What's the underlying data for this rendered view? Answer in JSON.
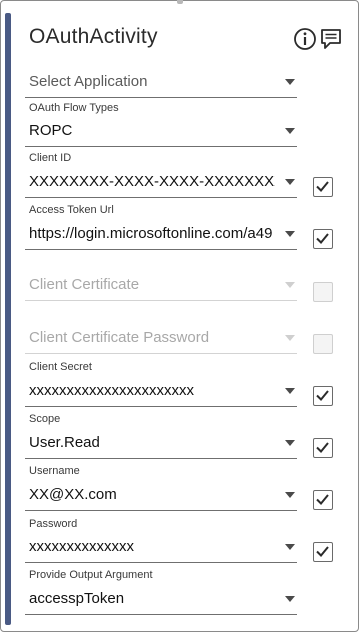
{
  "header": {
    "title": "OAuthActivity",
    "icons": [
      "info-icon",
      "comment-icon"
    ]
  },
  "fields": {
    "application": {
      "label": "",
      "value": "Select Application",
      "is_placeholder": true
    },
    "flow_types": {
      "label": "OAuth Flow Types",
      "value": "ROPC"
    },
    "client_id": {
      "label": "Client ID",
      "value": "XXXXXXXX-XXXX-XXXX-XXXXXXXX",
      "checked": true
    },
    "access_token_url": {
      "label": "Access Token Url",
      "value": "https://login.microsoftonline.com/a49",
      "checked": true
    },
    "client_certificate": {
      "label": "",
      "value": "Client Certificate",
      "checked": false,
      "disabled": true
    },
    "client_certificate_password": {
      "label": "",
      "value": "Client Certificate Password",
      "checked": false,
      "disabled": true
    },
    "client_secret": {
      "label": "Client Secret",
      "value": "xxxxxxxxxxxxxxxxxxxxxx",
      "checked": true
    },
    "scope": {
      "label": "Scope",
      "value": "User.Read",
      "checked": true
    },
    "username": {
      "label": "Username",
      "value": "XX@XX.com",
      "checked": true
    },
    "password": {
      "label": "Password",
      "value": "xxxxxxxxxxxxxx",
      "checked": true
    },
    "output_argument": {
      "label": "Provide Output Argument",
      "value": "accesspToken"
    }
  },
  "colors": {
    "accent_bar": "#4a5a84",
    "border": "#8a8a8a",
    "underline": "#6f6f6f",
    "disabled_text": "#a8a8a8"
  }
}
